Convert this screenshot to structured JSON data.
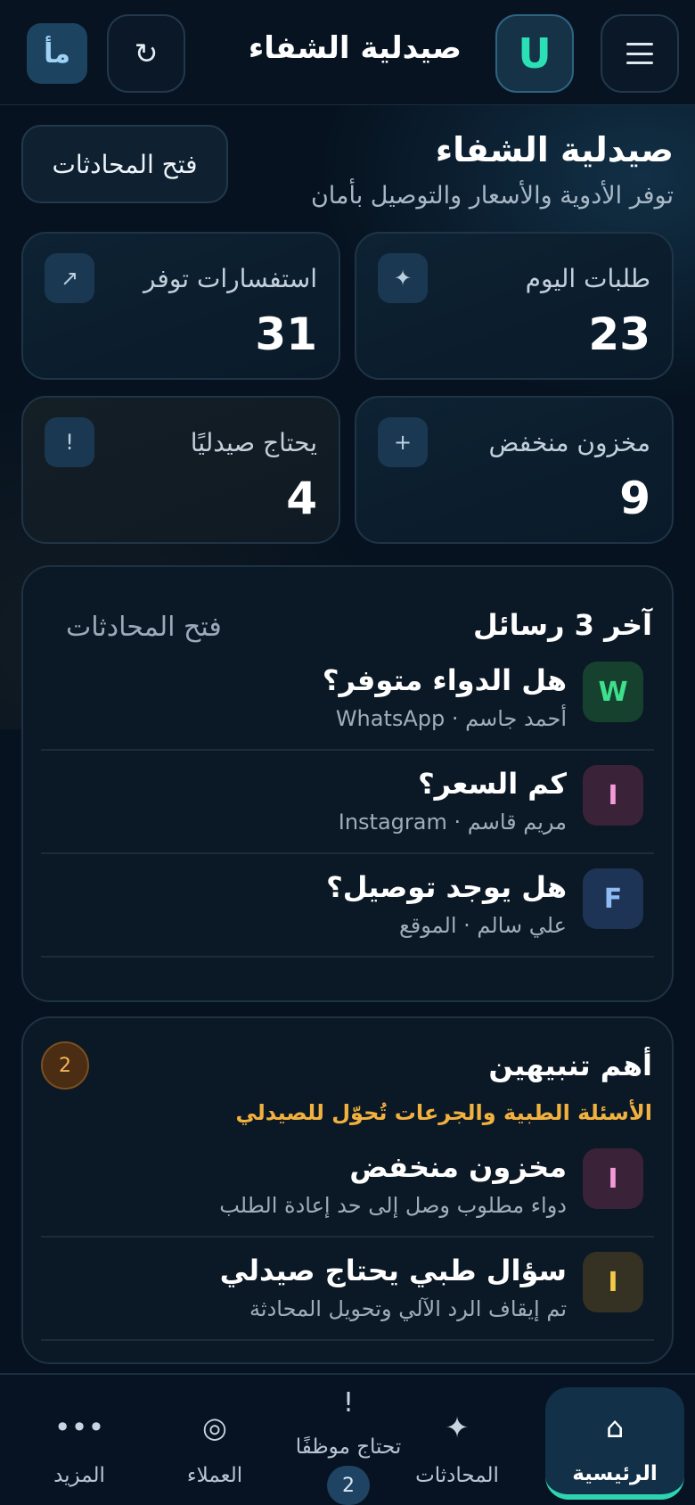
{
  "header": {
    "title": "صيدلية الشفاء",
    "avatar_letter": "U",
    "refresh_glyph": "↻",
    "lang_label": "مأ"
  },
  "hero": {
    "title": "صيدلية الشفاء",
    "subtitle": "توفر الأدوية والأسعار والتوصيل بأمان",
    "open_chats_label": "فتح المحادثات"
  },
  "stats": [
    {
      "label": "طلبات اليوم",
      "value": "23",
      "icon": "sparkle-icon",
      "glyph": "✦"
    },
    {
      "label": "استفسارات توفر",
      "value": "31",
      "icon": "trend-arrow-icon",
      "glyph": "↗"
    },
    {
      "label": "مخزون منخفض",
      "value": "9",
      "icon": "plus-icon",
      "glyph": "+"
    },
    {
      "label": "يحتاج صيدليًا",
      "value": "4",
      "icon": "exclamation-icon",
      "glyph": "!"
    }
  ],
  "messages": {
    "title": "آخر 3 رسائل",
    "open_link": "فتح المحادثات",
    "items": [
      {
        "letter": "W",
        "title": "هل الدواء متوفر؟",
        "meta": "أحمد جاسم · WhatsApp"
      },
      {
        "letter": "I",
        "title": "كم السعر؟",
        "meta": "مريم قاسم · Instagram"
      },
      {
        "letter": "F",
        "title": "هل يوجد توصيل؟",
        "meta": "علي سالم · الموقع"
      }
    ]
  },
  "alerts": {
    "title": "أهم تنبيهين",
    "count": "2",
    "note": "الأسئلة الطبية والجرعات تُحوّل للصيدلي",
    "items": [
      {
        "letter": "I",
        "title": "مخزون منخفض",
        "meta": "دواء مطلوب وصل إلى حد إعادة الطلب"
      },
      {
        "letter": "I",
        "title": "سؤال طبي يحتاج صيدلي",
        "meta": "تم إيقاف الرد الآلي وتحويل المحادثة"
      }
    ]
  },
  "nav": {
    "home": {
      "label": "الرئيسية",
      "glyph": "⌂"
    },
    "chats": {
      "label": "المحادثات",
      "glyph": "✦"
    },
    "staff": {
      "label": "تحتاج موظفًا",
      "glyph": "!",
      "badge": "2"
    },
    "customers": {
      "label": "العملاء",
      "glyph": "◎"
    },
    "more": {
      "label": "المزيد",
      "glyph": "•••"
    }
  },
  "colors": {
    "background": "#06121f",
    "accent": "#2dd4b0",
    "warning": "#f1b13f"
  }
}
